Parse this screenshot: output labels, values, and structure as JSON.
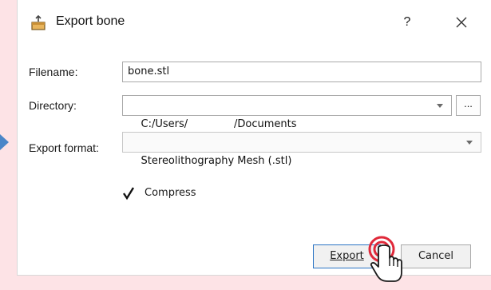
{
  "dialog": {
    "title": "Export bone",
    "help_label": "?",
    "icons": {
      "title": "export-box-icon",
      "close": "close-icon",
      "cursor": "hand-pointer-icon"
    }
  },
  "form": {
    "filename_label": "Filename:",
    "filename_value": "bone.stl",
    "directory_label": "Directory:",
    "directory_value": "C:/Users/              /Documents",
    "browse_label": "...",
    "format_label": "Export format:",
    "format_value": "Stereolithography Mesh (.stl)",
    "compress_label": "Compress",
    "compress_checked": true
  },
  "buttons": {
    "export_label": "Export",
    "cancel_label": "Cancel"
  },
  "colors": {
    "backdrop": "#fde3e6",
    "accent_border": "#2b74c4",
    "click_indicator": "#e0293a",
    "arrow": "#4a86c8"
  }
}
